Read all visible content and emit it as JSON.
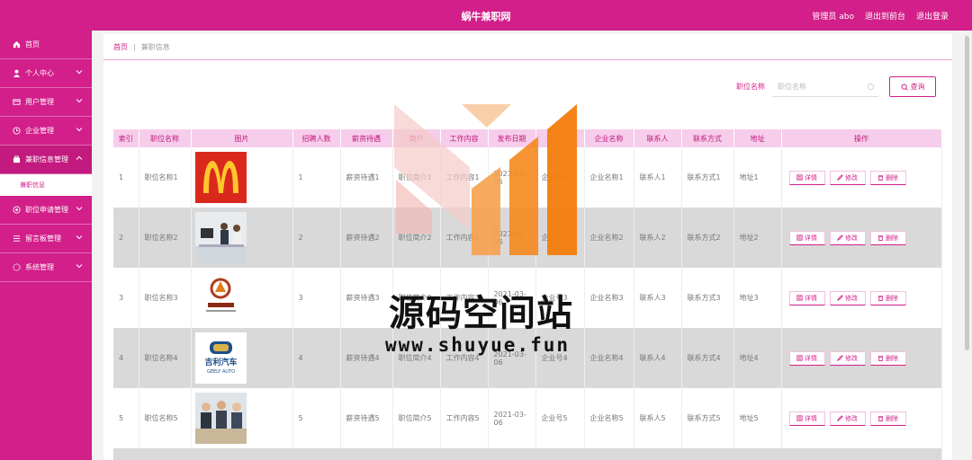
{
  "header": {
    "title": "蜗牛兼职网",
    "admin": "管理员 abo",
    "front": "退出到前台",
    "logout": "退出登录"
  },
  "sidebar": {
    "items": [
      {
        "label": "首页",
        "icon": "home-icon"
      },
      {
        "label": "个人中心",
        "icon": "user-icon"
      },
      {
        "label": "用户管理",
        "icon": "users-icon"
      },
      {
        "label": "企业管理",
        "icon": "clock-icon"
      },
      {
        "label": "兼职信息管理",
        "icon": "file-icon"
      }
    ],
    "sub_item": "兼职信息",
    "items2": [
      {
        "label": "职位申请管理",
        "icon": "apply-icon"
      },
      {
        "label": "留言板管理",
        "icon": "list-icon"
      },
      {
        "label": "系统管理",
        "icon": "system-icon"
      }
    ]
  },
  "breadcrumb": {
    "home": "首页",
    "sep": "|",
    "current": "兼职信息"
  },
  "search": {
    "label": "职位名称",
    "placeholder": "职位名称",
    "button": "查询"
  },
  "table": {
    "headers": [
      "索引",
      "职位名称",
      "图片",
      "招聘人数",
      "薪资待遇",
      "简介",
      "工作内容",
      "发布日期",
      "",
      "企业名称",
      "联系人",
      "联系方式",
      "地址",
      "操作"
    ],
    "rows": [
      {
        "idx": "1",
        "name": "职位名称1",
        "img": "mcdonalds",
        "count": "1",
        "salary": "薪资待遇1",
        "intro": "职位简介1",
        "work": "工作内容1",
        "date": "2021-03-06",
        "acct": "企业号1",
        "company": "企业名称1",
        "contact": "联系人1",
        "phone": "联系方式1",
        "addr": "地址1"
      },
      {
        "idx": "2",
        "name": "职位名称2",
        "img": "office",
        "count": "2",
        "salary": "薪资待遇2",
        "intro": "职位简介2",
        "work": "工作内容2",
        "date": "2021-03-06",
        "acct": "企业号2",
        "company": "企业名称2",
        "contact": "联系人2",
        "phone": "联系方式2",
        "addr": "地址2"
      },
      {
        "idx": "3",
        "name": "职位名称3",
        "img": "brand-logo",
        "count": "3",
        "salary": "薪资待遇3",
        "intro": "职位简介3",
        "work": "工作内容3",
        "date": "2021-03-06",
        "acct": "企业号3",
        "company": "企业名称3",
        "contact": "联系人3",
        "phone": "联系方式3",
        "addr": "地址3"
      },
      {
        "idx": "4",
        "name": "职位名称4",
        "img": "geely",
        "count": "4",
        "salary": "薪资待遇4",
        "intro": "职位简介4",
        "work": "工作内容4",
        "date": "2021-03-06",
        "acct": "企业号4",
        "company": "企业名称4",
        "contact": "联系人4",
        "phone": "联系方式4",
        "addr": "地址4"
      },
      {
        "idx": "5",
        "name": "职位名称5",
        "img": "meeting",
        "count": "5",
        "salary": "薪资待遇5",
        "intro": "职位简介5",
        "work": "工作内容5",
        "date": "2021-03-06",
        "acct": "企业号5",
        "company": "企业名称5",
        "contact": "联系人5",
        "phone": "联系方式5",
        "addr": "地址5"
      }
    ],
    "ops": {
      "detail": "详情",
      "edit": "修改",
      "del": "删除"
    },
    "geely_text": "吉利汽车",
    "geely_sub": "GEELY AUTO"
  },
  "watermark": {
    "line1": "源码空间站",
    "line2": "www.shuyue.fun"
  },
  "colors": {
    "brand": "#d21f8a",
    "header_bg": "#f6cdea"
  }
}
